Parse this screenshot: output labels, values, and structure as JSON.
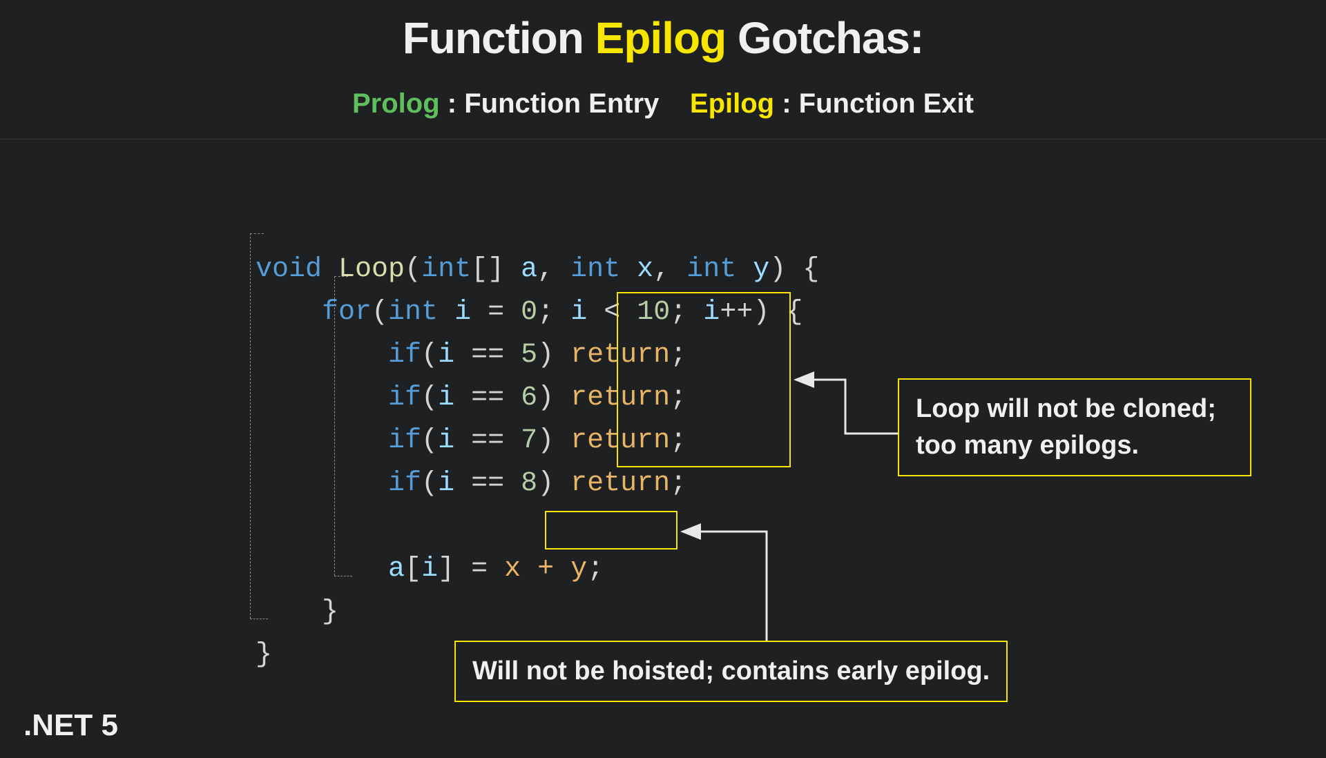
{
  "title": {
    "pre": "Function ",
    "hl": "Epilog",
    "post": " Gotchas:"
  },
  "subtitle": {
    "prolog_label": "Prolog",
    "prolog_desc": " : Function Entry",
    "epilog_label": "Epilog",
    "epilog_desc": " : Function Exit"
  },
  "code": {
    "l1": {
      "kw_void": "void",
      "fn": "Loop",
      "kw_int1": "int",
      "brackets": "[]",
      "var_a": "a",
      "kw_int2": "int",
      "var_x": "x",
      "kw_int3": "int",
      "var_y": "y",
      "open_brace": "{"
    },
    "l2": {
      "kw_for": "for",
      "kw_int": "int",
      "var_i": "i",
      "eq": "=",
      "zero": "0",
      "semi1": ";",
      "var_i2": "i",
      "lt": "<",
      "ten": "10",
      "semi2": ";",
      "var_i3": "i",
      "inc": "++",
      "open_brace": "{"
    },
    "if_lines": [
      {
        "kw_if": "if",
        "var_i": "i",
        "op": "==",
        "val": "5",
        "ret": "return",
        "semi": ";"
      },
      {
        "kw_if": "if",
        "var_i": "i",
        "op": "==",
        "val": "6",
        "ret": "return",
        "semi": ";"
      },
      {
        "kw_if": "if",
        "var_i": "i",
        "op": "==",
        "val": "7",
        "ret": "return",
        "semi": ";"
      },
      {
        "kw_if": "if",
        "var_i": "i",
        "op": "==",
        "val": "8",
        "ret": "return",
        "semi": ";"
      }
    ],
    "assign": {
      "arr": "a",
      "var_i": "i",
      "eq": "=",
      "x": "x",
      "plus": "+",
      "y": "y",
      "semi": ";"
    },
    "close_inner": "}",
    "close_outer": "}"
  },
  "callouts": {
    "right": "Loop will not be cloned;\ntoo many epilogs.",
    "bottom": "Will not be hoisted; contains early epilog."
  },
  "footer": ".NET 5"
}
